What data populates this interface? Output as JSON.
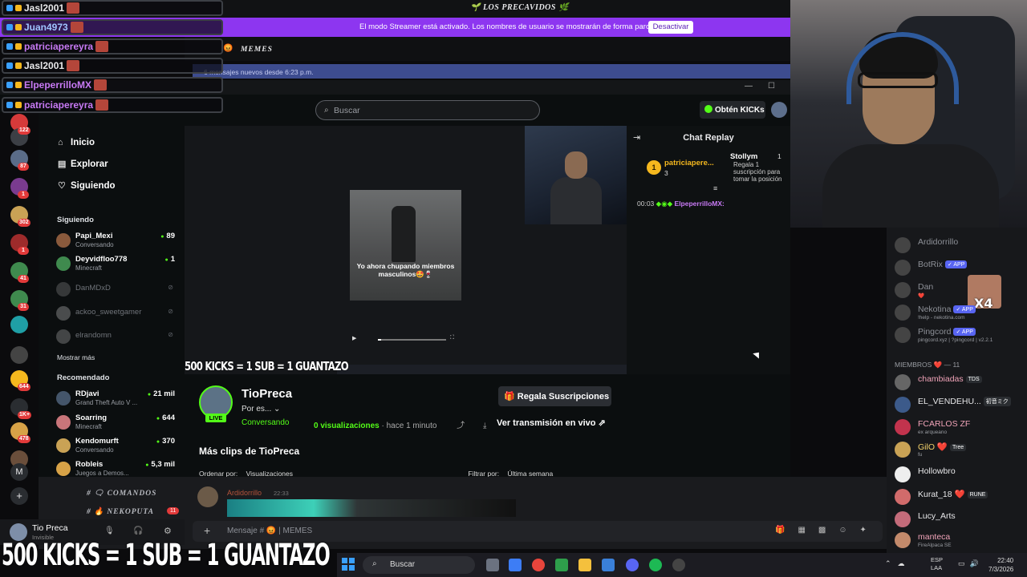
{
  "discord": {
    "channel_title": "🌱 LOS PRECAVIDOS 🌿",
    "header_channel": "MEMES",
    "new_messages": "6 mensajes nuevos desde 6:23 p.m.",
    "channels": [
      "COMANDOS",
      "NEKOPUTA"
    ],
    "channel_badge": "11",
    "message": {
      "author": "Ardidorrillo",
      "time": "22:33"
    },
    "composer_placeholder": "Mensaje # 😡 | MEMES",
    "user": {
      "name": "Tio Preca",
      "status": "Invisible"
    },
    "members_header": "MIEMBROS ❤️ — 11",
    "online_members": [
      {
        "name": "Ardidorrillo",
        "status": "",
        "color": "#8d9097"
      },
      {
        "name": "BotRix",
        "tag": "✓ APP",
        "status": "",
        "color": "#8d9097"
      },
      {
        "name": "Dan",
        "status": "❤️",
        "color": "#8d9097"
      },
      {
        "name": "Nekotina",
        "tag": "✓ APP",
        "status": "!help - nekotina.com",
        "color": "#8d9097"
      },
      {
        "name": "Pingcord",
        "tag": "✓ APP",
        "status": "pingcord.xyz | ?pingcord | v2.2.1",
        "color": "#8d9097"
      }
    ],
    "members": [
      {
        "name": "chambiadas",
        "tag": "TDS",
        "status": "",
        "color": "#f0a3b8"
      },
      {
        "name": "EL_VENDEHU...",
        "tag": "初音ミク",
        "status": "",
        "color": "#e8e8ea"
      },
      {
        "name": "FCARLOS ZF",
        "status": "ex arqueano",
        "color": "#f0a3b8"
      },
      {
        "name": "GilO ❤️",
        "tag": "Tree",
        "status": "fu",
        "color": "#f5d36b"
      },
      {
        "name": "Hollowbro",
        "status": "",
        "color": "#e8e8ea"
      },
      {
        "name": "Kurat_18 ❤️",
        "tag": "RUNE",
        "status": "",
        "color": "#e8e8ea"
      },
      {
        "name": "Lucy_Arts",
        "status": "",
        "color": "#e8e8ea"
      },
      {
        "name": "manteca",
        "status": "FireAlpaca SE",
        "color": "#f0a3b8"
      }
    ]
  },
  "streamer_banner": {
    "text": "El modo Streamer está activado. Los nombres de usuario se mostrarán de forma parcial.",
    "button": "Desactivar"
  },
  "chat_overlay": [
    {
      "name": "Jasl2001",
      "color": "#e8e8ea"
    },
    {
      "name": "Juan4973",
      "color": "#9fc4ff"
    },
    {
      "name": "patriciapereyra",
      "color": "#c87af5"
    },
    {
      "name": "Jasl2001",
      "color": "#e8e8ea"
    },
    {
      "name": "ElpeperrilloMX",
      "color": "#c87af5"
    },
    {
      "name": "patriciapereyra",
      "color": "#c87af5"
    }
  ],
  "kick": {
    "search_placeholder": "Buscar",
    "get_kicks": "Obtén KICKs",
    "nav": [
      {
        "label": "Inicio",
        "icon": "home-icon",
        "glyph": "⌂"
      },
      {
        "label": "Explorar",
        "icon": "browse-icon",
        "glyph": "▤"
      },
      {
        "label": "Siguiendo",
        "icon": "heart-icon",
        "glyph": "♡"
      }
    ],
    "following_header": "Siguiendo",
    "following": [
      {
        "name": "Papi_Mexi",
        "sub": "Conversando",
        "count": "89",
        "color": "#8a5a3c"
      },
      {
        "name": "Deyvidfloo778",
        "sub": "Minecraft",
        "count": "1",
        "color": "#3f8a4e"
      },
      {
        "name": "DanMDxD",
        "sub": "",
        "count": "",
        "color": "#777"
      },
      {
        "name": "ackoo_sweetgamer",
        "sub": "",
        "count": "",
        "color": "#aaa"
      },
      {
        "name": "elrandomn",
        "sub": "",
        "count": "",
        "color": "#999"
      }
    ],
    "show_more": "Mostrar más",
    "recommended_header": "Recomendado",
    "recommended": [
      {
        "name": "RDjavi",
        "sub": "Grand Theft Auto V ...",
        "count": "21 mil",
        "color": "#44556a"
      },
      {
        "name": "Soarring",
        "sub": "Minecraft",
        "count": "644",
        "color": "#c8757a"
      },
      {
        "name": "Kendomurft",
        "sub": "Conversando",
        "count": "370",
        "color": "#c9a255"
      },
      {
        "name": "Robleis",
        "sub": "Juegos a Demos...",
        "count": "5,3 mil",
        "color": "#d7a247"
      }
    ],
    "clip_caption": "Yo ahora chupando miembros masculinos🤩🍷",
    "replay": {
      "title": "Chat Replay",
      "pinned_name": "patriciapere...",
      "pinned_sub": "3",
      "gift_name": "Stollym",
      "gift_text": "Regala 1 suscripción para tomar la posición",
      "gift_count": "1",
      "msg_time": "00:03",
      "msg_name": "ElpeperrilloMX:"
    },
    "stream": {
      "name": "TioPreca",
      "by": "Por es...",
      "live": "LIVE",
      "category": "Conversando",
      "views_count": "0 visualizaciones",
      "time_ago": "· hace 1 minuto",
      "gift_button": "Regala Suscripciones",
      "watch_live": "Ver transmisión en vivo",
      "clips_header": "Más clips de TioPreca",
      "sort_label": "Ordenar por:",
      "sort_value": "Visualizaciones",
      "filter_label": "Filtrar por:",
      "filter_value": "Última semana"
    }
  },
  "overlay_text": "500 KICKS = 1 SUB = 1 GUANTAZO",
  "server_badges": [
    "122",
    "87",
    "1",
    "302",
    "1",
    "41",
    "31",
    "644",
    "1K+",
    "478"
  ],
  "taskbar": {
    "search": "Buscar",
    "lang": "ESP\nLAA",
    "time": "22:40",
    "date": "7/3/2026"
  },
  "x4": "X4",
  "colors": {
    "kick_green": "#53fc18",
    "streamer_purple": "#8d36f0",
    "discord_blurple": "#5865f2"
  }
}
